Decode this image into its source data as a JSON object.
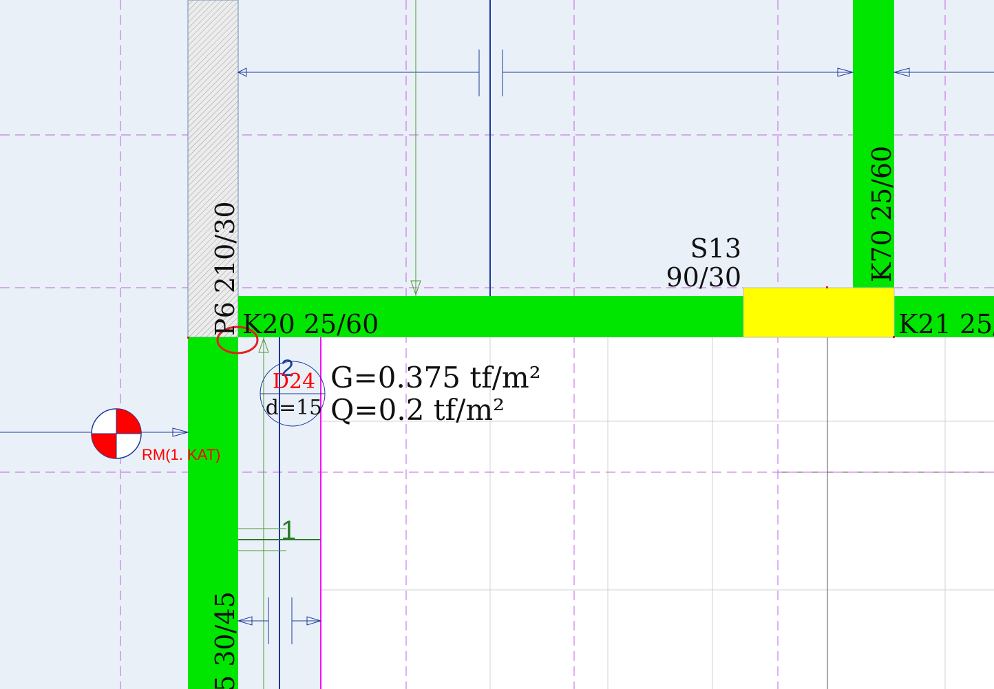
{
  "colors": {
    "background": "#eaf0f8",
    "slab_area": "#ffffff",
    "beam_fill": "#00e600",
    "column_fill": "#ffff00",
    "grid_dashed": "#c060e0",
    "dim_line": "#1a3a9a",
    "label_text": "#111111",
    "slab_label_red": "#ff0000",
    "highlight_circle": "#e02020"
  },
  "elements": {
    "beam_k20": {
      "label": "K20 25/60"
    },
    "beam_k21": {
      "label": "K21 25/"
    },
    "beam_k70": {
      "label": "K70 25/60"
    },
    "wall_p6": {
      "label": "P6 210/30"
    },
    "beam_left": {
      "label": "5 30/45"
    },
    "column_s13": {
      "name": "S13",
      "size": "90/30"
    }
  },
  "slab": {
    "top_number": "2",
    "name": "D24",
    "thickness": "d=15",
    "dead_load": "G=0.375 tf/m²",
    "live_load": "Q=0.2 tf/m²"
  },
  "support": {
    "label": "RM(1. KAT)",
    "icon": "support-point-icon"
  },
  "markers": {
    "node_marker": "1"
  }
}
